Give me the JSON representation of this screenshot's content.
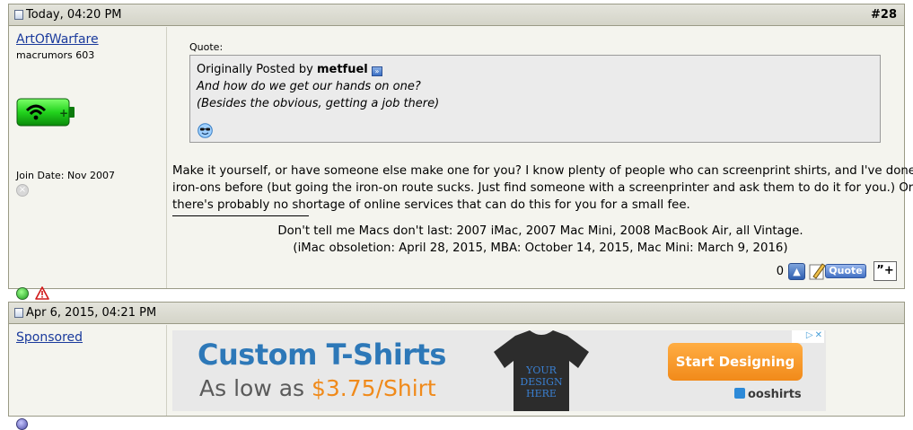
{
  "posts": [
    {
      "date": "Today, 04:20 PM",
      "number": "#28",
      "user": {
        "name": "ArtOfWarfare",
        "title": "macrumors 603",
        "join_date": "Join Date: Nov 2007"
      },
      "quote": {
        "label": "Quote:",
        "intro": "Originally Posted by",
        "author": "metfuel",
        "line1": "And how do we get our hands on one?",
        "line2": "(Besides the obvious, getting a job there)"
      },
      "message": "Make it yourself, or have someone else make one for you? I know plenty of people who can screenprint shirts, and I've done iron-ons before (but going the iron-on route sucks. Just find someone with a screenprinter and ask them to do it for you.) Or there's probably no shortage of online services that can do this for you for a small fee.",
      "signature": {
        "line1": "Don't tell me Macs don't last: 2007 iMac, 2007 Mac Mini, 2008 MacBook Air, all Vintage.",
        "line2": "(iMac obsoletion: April 28, 2015, MBA: October 14, 2015, Mac Mini: March 9, 2016)"
      },
      "footer": {
        "rep_count": "0",
        "quote_label": "Quote"
      }
    },
    {
      "date": "Apr 6, 2015, 04:21 PM",
      "user": {
        "name": "Sponsored"
      },
      "ad": {
        "headline": "Custom T-Shirts",
        "sub_prefix": "As low as ",
        "price": "$3.75/Shirt",
        "shirt_text_1": "YOUR",
        "shirt_text_2": "DESIGN",
        "shirt_text_3": "HERE",
        "cta": "Start Designing",
        "brand": "ooshirts"
      }
    }
  ],
  "colors": {
    "header_bg": "#d8d8cc",
    "post_bg": "#f4f4ee",
    "link": "#1a3a9c",
    "ad_blue": "#2d78b8",
    "ad_orange": "#f08a1a"
  },
  "icons": {
    "post_icon": "document-icon",
    "status_online": "online-dot-icon",
    "report": "report-warning-icon",
    "reputation": "thumbs-up-icon",
    "quote": "quote-pen-icon",
    "multiquote": "multiquote-icon"
  }
}
